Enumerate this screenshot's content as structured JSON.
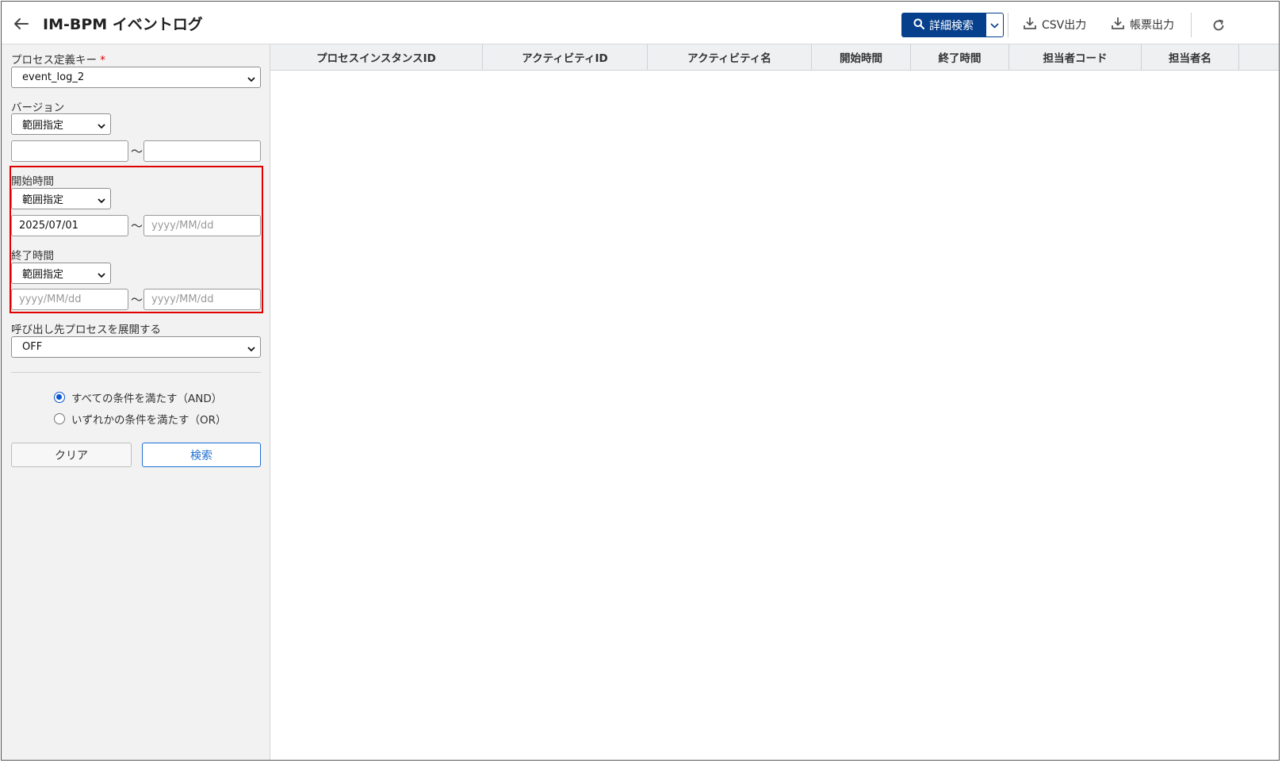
{
  "header": {
    "title": "IM-BPM イベントログ",
    "detail_search_label": "詳細検索",
    "csv_label": "CSV出力",
    "report_label": "帳票出力"
  },
  "sidebar": {
    "process_key": {
      "label": "プロセス定義キー",
      "required_mark": "*",
      "value": "event_log_2"
    },
    "version": {
      "label": "バージョン",
      "mode": "範囲指定",
      "from": "",
      "to": ""
    },
    "start_time": {
      "label": "開始時間",
      "mode": "範囲指定",
      "from": "2025/07/01",
      "to_placeholder": "yyyy/MM/dd"
    },
    "end_time": {
      "label": "終了時間",
      "mode": "範囲指定",
      "from_placeholder": "yyyy/MM/dd",
      "to_placeholder": "yyyy/MM/dd"
    },
    "expand_calls": {
      "label": "呼び出し先プロセスを展開する",
      "value": "OFF"
    },
    "tilde": "～",
    "condition_and": "すべての条件を満たす（AND）",
    "condition_or": "いずれかの条件を満たす（OR）",
    "clear_label": "クリア",
    "search_label": "検索"
  },
  "table": {
    "columns": [
      "プロセスインスタンスID",
      "アクティビティID",
      "アクティビティ名",
      "開始時間",
      "終了時間",
      "担当者コード",
      "担当者名"
    ]
  },
  "colors": {
    "accent": "#063f8c",
    "highlight": "#e00000",
    "radio": "#0b57d0"
  }
}
